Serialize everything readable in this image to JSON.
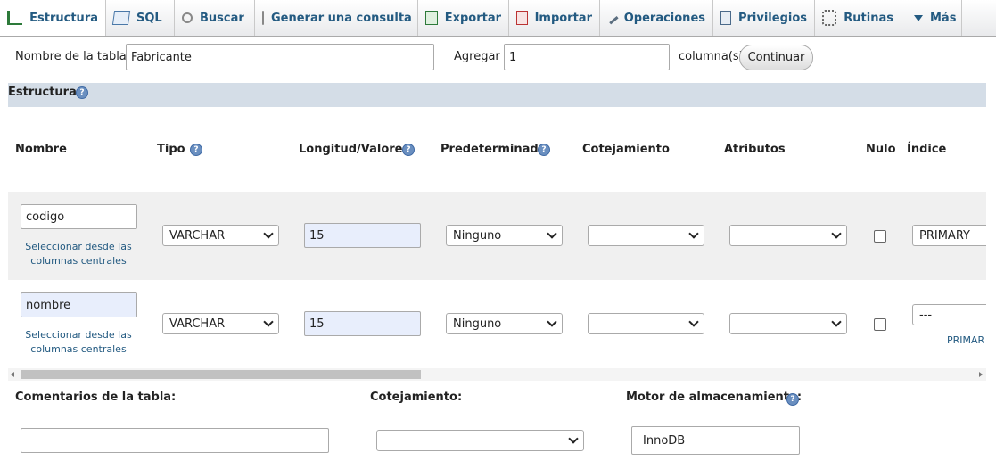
{
  "tabs": [
    {
      "label": "Estructura",
      "icon": "structure-icon"
    },
    {
      "label": "SQL",
      "icon": "sql-icon"
    },
    {
      "label": "Buscar",
      "icon": "search-icon"
    },
    {
      "label": "Generar una consulta",
      "icon": "query-icon"
    },
    {
      "label": "Exportar",
      "icon": "export-icon"
    },
    {
      "label": "Importar",
      "icon": "import-icon"
    },
    {
      "label": "Operaciones",
      "icon": "wrench-icon"
    },
    {
      "label": "Privilegios",
      "icon": "privileges-icon"
    },
    {
      "label": "Rutinas",
      "icon": "routines-icon"
    },
    {
      "label": "Más",
      "icon": "dropdown-triangle-icon"
    }
  ],
  "form": {
    "table_name_label": "Nombre de la tabla:",
    "table_name_value": "Fabricante",
    "add_label": "Agregar",
    "add_value": "1",
    "columns_label": "columna(s)",
    "continue_button": "Continuar"
  },
  "section_title": "Estructura",
  "headers": {
    "nombre": "Nombre",
    "tipo": "Tipo",
    "longitud": "Longitud/Valores",
    "predeterminado": "Predeterminado",
    "cotejamiento": "Cotejamiento",
    "atributos": "Atributos",
    "nulo": "Nulo",
    "indice": "Índice"
  },
  "rows": [
    {
      "name": "codigo",
      "central_link": "Seleccionar desde las columnas centrales",
      "type": "VARCHAR",
      "length": "15",
      "default": "Ninguno",
      "collation": "",
      "attributes": "",
      "null": false,
      "index": "PRIMARY",
      "index_link": ""
    },
    {
      "name": "nombre",
      "central_link": "Seleccionar desde las columnas centrales",
      "type": "VARCHAR",
      "length": "15",
      "default": "Ninguno",
      "collation": "",
      "attributes": "",
      "null": false,
      "index": "---",
      "index_link": "PRIMAR"
    }
  ],
  "footer": {
    "comments_label": "Comentarios de la tabla:",
    "comments_value": "",
    "collation_label": "Cotejamiento:",
    "collation_value": "",
    "engine_label": "Motor de almacenamiento:",
    "engine_value": "InnoDB"
  },
  "scrollbar": {
    "position": 0.0,
    "visible_fraction": 0.42
  }
}
